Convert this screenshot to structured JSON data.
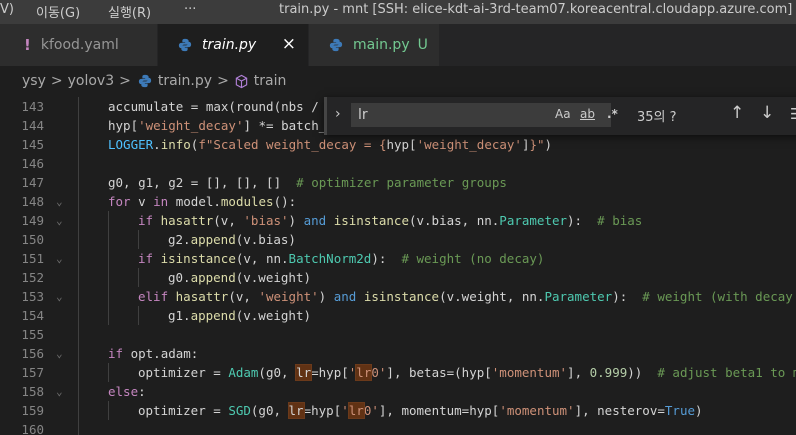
{
  "titlebar": {
    "menu": [
      {
        "label": "V)"
      },
      {
        "label": "이동(G)"
      },
      {
        "label": "실행(R)"
      },
      {
        "label": "···"
      }
    ],
    "window_title": "train.py - mnt [SSH: elice-kdt-ai-3rd-team07.koreacentral.cloudapp.azure.com]"
  },
  "tabs": [
    {
      "label": "kfood.yaml",
      "icon": "exclamation-icon"
    },
    {
      "label": "train.py",
      "icon": "python-icon",
      "active": true,
      "close": "×"
    },
    {
      "label": "main.py",
      "icon": "python-icon",
      "status": "U"
    }
  ],
  "breadcrumb": {
    "parts": [
      "ysy",
      "yolov3",
      "train.py",
      "train"
    ],
    "separator": ">"
  },
  "find": {
    "query": "lr",
    "match_case": "Aa",
    "whole_word": "ab",
    "regex": ".*",
    "count": "35의 ?",
    "up": "↑",
    "down": "↓",
    "selection": "☰",
    "toggle": "›"
  },
  "editor": {
    "lines": [
      {
        "n": "143",
        "ind": 1,
        "t": [
          [
            "accumulate = max(round(nbs / ",
            "#d4d4d4"
          ]
        ]
      },
      {
        "n": "144",
        "ind": 1,
        "t": [
          [
            "hyp[",
            "#d4d4d4"
          ],
          [
            "'weight_decay'",
            "#ce9178"
          ],
          [
            "] *= batch_",
            "#d4d4d4"
          ]
        ]
      },
      {
        "n": "145",
        "ind": 1,
        "t": [
          [
            "LOGGER",
            "#4fc1ff"
          ],
          [
            ".",
            "#d4d4d4"
          ],
          [
            "info",
            "#dcdcaa"
          ],
          [
            "(",
            "#d4d4d4"
          ],
          [
            "f\"Scaled weight_decay = {",
            "#ce9178"
          ],
          [
            "hyp[",
            "#d4d4d4"
          ],
          [
            "'weight_decay'",
            "#ce9178"
          ],
          [
            "]",
            "#d4d4d4"
          ],
          [
            "}\"",
            "#ce9178"
          ],
          [
            ")",
            "#d4d4d4"
          ]
        ]
      },
      {
        "n": "146",
        "ind": 1,
        "t": []
      },
      {
        "n": "147",
        "ind": 1,
        "t": [
          [
            "g0, g1, g2 = [], [], []  ",
            "#d4d4d4"
          ],
          [
            "# optimizer parameter groups",
            "#6a9955"
          ]
        ]
      },
      {
        "n": "148",
        "ind": 1,
        "fold": true,
        "t": [
          [
            "for",
            "#c586c0"
          ],
          [
            " v ",
            "#d4d4d4"
          ],
          [
            "in",
            "#c586c0"
          ],
          [
            " model.",
            "#d4d4d4"
          ],
          [
            "modules",
            "#dcdcaa"
          ],
          [
            "():",
            "#d4d4d4"
          ]
        ]
      },
      {
        "n": "149",
        "ind": 2,
        "fold": true,
        "t": [
          [
            "if",
            "#c586c0"
          ],
          [
            " ",
            "#d4d4d4"
          ],
          [
            "hasattr",
            "#dcdcaa"
          ],
          [
            "(v, ",
            "#d4d4d4"
          ],
          [
            "'bias'",
            "#ce9178"
          ],
          [
            ") ",
            "#d4d4d4"
          ],
          [
            "and",
            "#569cd6"
          ],
          [
            " ",
            "#d4d4d4"
          ],
          [
            "isinstance",
            "#dcdcaa"
          ],
          [
            "(v.bias, nn.",
            "#d4d4d4"
          ],
          [
            "Parameter",
            "#4ec9b0"
          ],
          [
            "):  ",
            "#d4d4d4"
          ],
          [
            "# bias",
            "#6a9955"
          ]
        ]
      },
      {
        "n": "150",
        "ind": 3,
        "t": [
          [
            "g2.",
            "#d4d4d4"
          ],
          [
            "append",
            "#dcdcaa"
          ],
          [
            "(v.bias)",
            "#d4d4d4"
          ]
        ]
      },
      {
        "n": "151",
        "ind": 2,
        "fold": true,
        "t": [
          [
            "if",
            "#c586c0"
          ],
          [
            " ",
            "#d4d4d4"
          ],
          [
            "isinstance",
            "#dcdcaa"
          ],
          [
            "(v, nn.",
            "#d4d4d4"
          ],
          [
            "BatchNorm2d",
            "#4ec9b0"
          ],
          [
            "):  ",
            "#d4d4d4"
          ],
          [
            "# weight (no decay)",
            "#6a9955"
          ]
        ]
      },
      {
        "n": "152",
        "ind": 3,
        "t": [
          [
            "g0.",
            "#d4d4d4"
          ],
          [
            "append",
            "#dcdcaa"
          ],
          [
            "(v.weight)",
            "#d4d4d4"
          ]
        ]
      },
      {
        "n": "153",
        "ind": 2,
        "fold": true,
        "t": [
          [
            "elif",
            "#c586c0"
          ],
          [
            " ",
            "#d4d4d4"
          ],
          [
            "hasattr",
            "#dcdcaa"
          ],
          [
            "(v, ",
            "#d4d4d4"
          ],
          [
            "'weight'",
            "#ce9178"
          ],
          [
            ") ",
            "#d4d4d4"
          ],
          [
            "and",
            "#569cd6"
          ],
          [
            " ",
            "#d4d4d4"
          ],
          [
            "isinstance",
            "#dcdcaa"
          ],
          [
            "(v.weight, nn.",
            "#d4d4d4"
          ],
          [
            "Parameter",
            "#4ec9b0"
          ],
          [
            "):  ",
            "#d4d4d4"
          ],
          [
            "# weight (with decay",
            "#6a9955"
          ]
        ]
      },
      {
        "n": "154",
        "ind": 3,
        "t": [
          [
            "g1.",
            "#d4d4d4"
          ],
          [
            "append",
            "#dcdcaa"
          ],
          [
            "(v.weight)",
            "#d4d4d4"
          ]
        ]
      },
      {
        "n": "155",
        "ind": 1,
        "t": []
      },
      {
        "n": "156",
        "ind": 1,
        "fold": true,
        "t": [
          [
            "if",
            "#c586c0"
          ],
          [
            " opt.adam:",
            "#d4d4d4"
          ]
        ]
      },
      {
        "n": "157",
        "ind": 2,
        "t": [
          [
            "optimizer = ",
            "#d4d4d4"
          ],
          [
            "Adam",
            "#4ec9b0"
          ],
          [
            "(g0, ",
            "#d4d4d4"
          ],
          [
            "lr",
            "#d4d4d4",
            "hl"
          ],
          [
            "=hyp[",
            "#d4d4d4"
          ],
          [
            "'",
            "#ce9178"
          ],
          [
            "lr",
            "#ce9178",
            "hl"
          ],
          [
            "0'",
            "#ce9178"
          ],
          [
            "], betas=(hyp[",
            "#d4d4d4"
          ],
          [
            "'momentum'",
            "#ce9178"
          ],
          [
            "], ",
            "#d4d4d4"
          ],
          [
            "0.999",
            "#b5cea8"
          ],
          [
            "))  ",
            "#d4d4d4"
          ],
          [
            "# adjust beta1 to m",
            "#6a9955"
          ]
        ]
      },
      {
        "n": "158",
        "ind": 1,
        "fold": true,
        "t": [
          [
            "else",
            "#c586c0"
          ],
          [
            ":",
            "#d4d4d4"
          ]
        ]
      },
      {
        "n": "159",
        "ind": 2,
        "t": [
          [
            "optimizer = ",
            "#d4d4d4"
          ],
          [
            "SGD",
            "#4ec9b0"
          ],
          [
            "(g0, ",
            "#d4d4d4"
          ],
          [
            "lr",
            "#d4d4d4",
            "hl"
          ],
          [
            "=hyp[",
            "#d4d4d4"
          ],
          [
            "'",
            "#ce9178"
          ],
          [
            "lr",
            "#ce9178",
            "hl"
          ],
          [
            "0'",
            "#ce9178"
          ],
          [
            "], momentum=hyp[",
            "#d4d4d4"
          ],
          [
            "'momentum'",
            "#ce9178"
          ],
          [
            "], nesterov=",
            "#d4d4d4"
          ],
          [
            "True",
            "#569cd6"
          ],
          [
            ")",
            "#d4d4d4"
          ]
        ]
      },
      {
        "n": "160",
        "ind": 1,
        "t": []
      }
    ]
  }
}
